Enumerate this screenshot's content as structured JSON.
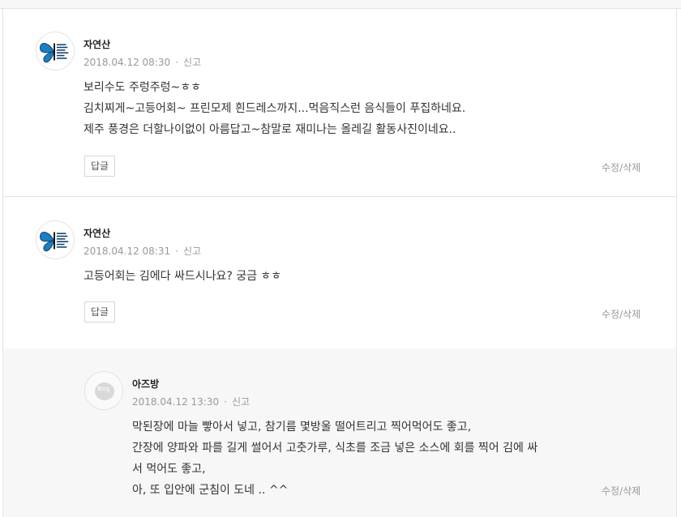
{
  "comments": [
    {
      "author": "자연산",
      "date": "2018.04.12 08:30",
      "dot": "·",
      "report": "신고",
      "lines": [
        "보리수도 주렁주렁~ㅎㅎ",
        "김치찌게~고등어회~ 프린모제 흰드레스까지...먹음직스런 음식들이 푸집하네요.",
        "제주 풍경은 더할나이없이 아름답고~참말로 재미나는 올레길 활동사진이네요.."
      ],
      "reply_label": "답글",
      "edit_delete": "수정/삭제",
      "avatar_icon": "butterfly-avatar-icon"
    },
    {
      "author": "자연산",
      "date": "2018.04.12 08:31",
      "dot": "·",
      "report": "신고",
      "lines": [
        "고등어회는 김에다 싸드시나요? 궁금 ㅎㅎ"
      ],
      "reply_label": "답글",
      "edit_delete": "수정/삭제",
      "avatar_icon": "butterfly-avatar-icon"
    }
  ],
  "reply": {
    "author": "아즈방",
    "date": "2018.04.12 13:30",
    "dot": "·",
    "report": "신고",
    "avatar_text": "Blog",
    "lines": [
      "막된장에 마늘 빻아서 넣고, 참기름 몇방울 떨어트리고 찍어먹어도 좋고,",
      "간장에 양파와 파를 길게 썰어서 고춧가루, 식초를 조금 넣은 소스에 회를 찍어 김에 싸",
      "서 먹어도 좋고,",
      "아, 또 입안에 군침이 도네 .. ^^"
    ],
    "edit_delete": "수정/삭제"
  },
  "colors": {
    "reply_bg": "#f7f7f7",
    "border": "#e4e4e4",
    "meta": "#999999",
    "butterfly": "#1a7fc4"
  }
}
